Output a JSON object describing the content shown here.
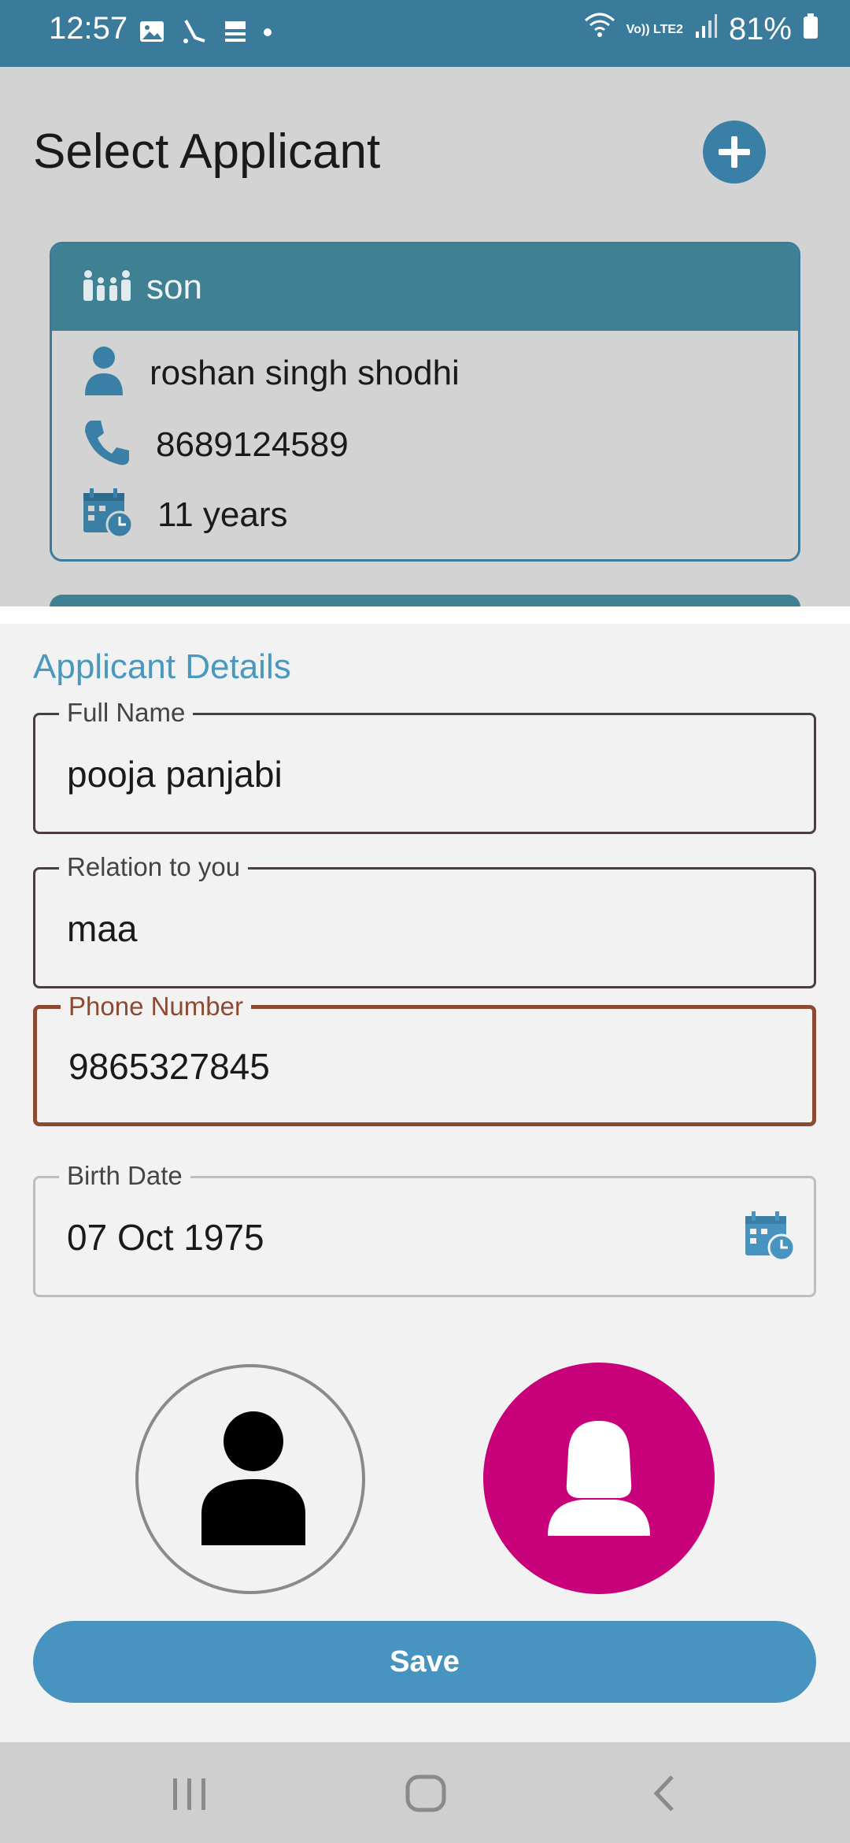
{
  "status_bar": {
    "time": "12:57",
    "network": "Vo)) LTE2",
    "battery": "81%",
    "icons": [
      "image-icon",
      "cricket-icon",
      "news-app-icon",
      "dot-icon",
      "wifi-icon",
      "signal-icon",
      "battery-icon"
    ]
  },
  "header": {
    "title": "Select Applicant",
    "add_icon": "plus-icon"
  },
  "applicant_card": {
    "relation": "son",
    "name": "roshan singh shodhi",
    "phone": "8689124589",
    "age": "11 years"
  },
  "form": {
    "title": "Applicant Details",
    "full_name": {
      "label": "Full Name",
      "value": "pooja panjabi"
    },
    "relation": {
      "label": "Relation to you",
      "value": "maa"
    },
    "phone": {
      "label": "Phone Number",
      "value": "9865327845"
    },
    "birth_date": {
      "label": "Birth Date",
      "value": "07 Oct 1975"
    },
    "gender_selected": "female",
    "save_label": "Save"
  },
  "colors": {
    "status_bar": "#3a7a9a",
    "accent": "#4694bf",
    "card_header": "#3f8093",
    "female_selected": "#c8007a",
    "focus_border": "#8c4a33"
  },
  "nav": {
    "icons": [
      "recents-icon",
      "home-icon",
      "back-icon"
    ]
  }
}
